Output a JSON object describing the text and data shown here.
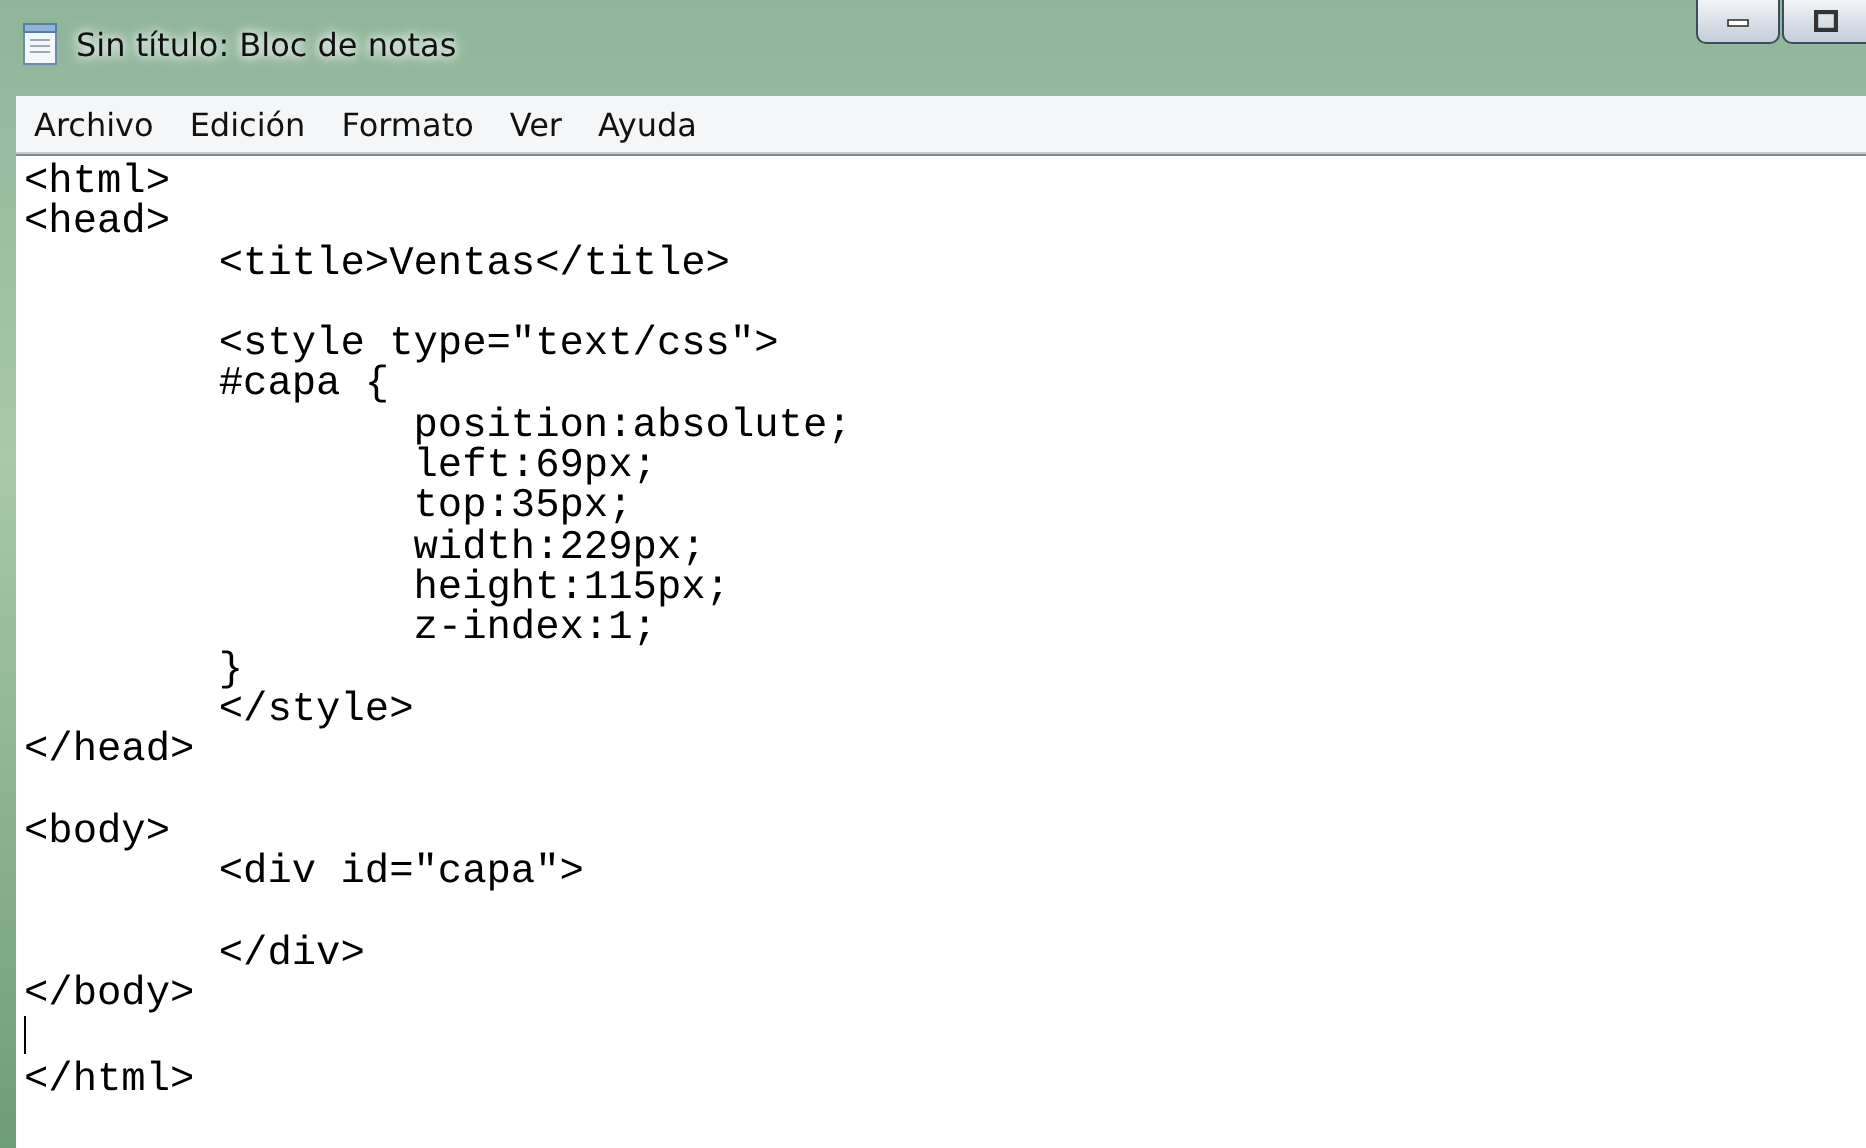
{
  "window": {
    "title": "Sin título: Bloc de notas"
  },
  "menu": [
    "Archivo",
    "Edición",
    "Formato",
    "Ver",
    "Ayuda"
  ],
  "editor": {
    "text": "<html>\n<head>\n\t<title>Ventas</title>\n\n\t<style type=\"text/css\">\n\t#capa {\n\t\tposition:absolute;\n\t\tleft:69px;\n\t\ttop:35px;\n\t\twidth:229px;\n\t\theight:115px;\n\t\tz-index:1;\n\t}\n\t</style>\n</head>\n\n<body>\n\t<div id=\"capa\">\n\n\t</div>\n</body>\n",
    "after_caret": "\n</html>"
  }
}
